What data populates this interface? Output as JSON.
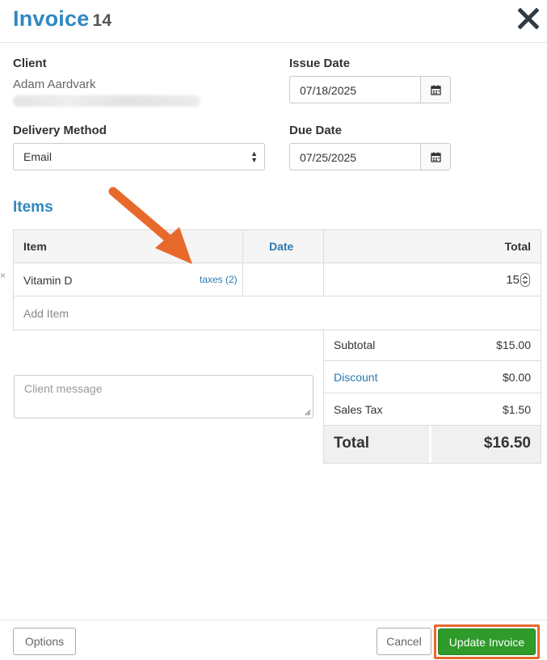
{
  "header": {
    "title": "Invoice",
    "number": "14"
  },
  "client": {
    "label": "Client",
    "name": "Adam Aardvark"
  },
  "issue_date": {
    "label": "Issue Date",
    "value": "07/18/2025"
  },
  "delivery": {
    "label": "Delivery Method",
    "selected": "Email"
  },
  "due_date": {
    "label": "Due Date",
    "value": "07/25/2025"
  },
  "items": {
    "title": "Items",
    "columns": {
      "item": "Item",
      "date": "Date",
      "total": "Total"
    },
    "rows": [
      {
        "name": "Vitamin D",
        "taxes_link": "taxes (2)",
        "date": "",
        "qty": "15"
      }
    ],
    "add_placeholder": "Add Item",
    "remove_glyph": "×"
  },
  "message": {
    "placeholder": "Client message"
  },
  "totals": {
    "subtotal_label": "Subtotal",
    "subtotal": "$15.00",
    "discount_label": "Discount",
    "discount": "$0.00",
    "tax_label": "Sales Tax",
    "tax": "$1.50",
    "total_label": "Total",
    "total": "$16.50"
  },
  "footer": {
    "options": "Options",
    "cancel": "Cancel",
    "update": "Update Invoice"
  },
  "colors": {
    "brand_blue": "#2f88c0",
    "link_blue": "#2a79b4",
    "primary_green": "#2f9b2a",
    "highlight_orange": "#e8692c"
  }
}
